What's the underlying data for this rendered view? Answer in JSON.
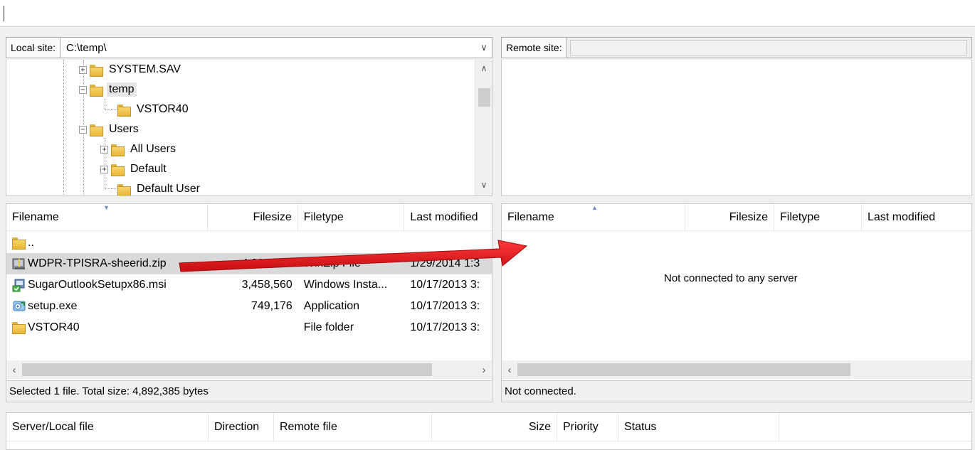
{
  "local_site": {
    "label": "Local site:",
    "path": "C:\\temp\\"
  },
  "remote_site": {
    "label": "Remote site:"
  },
  "tree": [
    {
      "name": "SYSTEM.SAV",
      "expander": "+"
    },
    {
      "name": "temp",
      "expander": "−",
      "selected": true
    },
    {
      "name": "VSTOR40",
      "expander": ""
    },
    {
      "name": "Users",
      "expander": "−"
    },
    {
      "name": "All Users",
      "expander": "+"
    },
    {
      "name": "Default",
      "expander": "+"
    },
    {
      "name": "Default User",
      "expander": ""
    }
  ],
  "local_list": {
    "columns": [
      "Filename",
      "Filesize",
      "Filetype",
      "Last modified"
    ],
    "rows": [
      {
        "name": "..",
        "size": "",
        "type": "",
        "modified": "",
        "icon": "folder-icon"
      },
      {
        "name": "WDPR-TPISRA-sheerid.zip",
        "size": "4,892,385",
        "type": "WinZip File",
        "modified": "1/29/2014 1:3",
        "icon": "zip-icon",
        "selected": true
      },
      {
        "name": "SugarOutlookSetupx86.msi",
        "size": "3,458,560",
        "type": "Windows Insta...",
        "modified": "10/17/2013 3:",
        "icon": "installer-icon"
      },
      {
        "name": "setup.exe",
        "size": "749,176",
        "type": "Application",
        "modified": "10/17/2013 3:",
        "icon": "setup-icon"
      },
      {
        "name": "VSTOR40",
        "size": "",
        "type": "File folder",
        "modified": "10/17/2013 3:",
        "icon": "folder-icon"
      }
    ],
    "status": "Selected 1 file. Total size: 4,892,385 bytes"
  },
  "remote_list": {
    "columns": [
      "Filename",
      "Filesize",
      "Filetype",
      "Last modified"
    ],
    "empty_message": "Not connected to any server",
    "status": "Not connected."
  },
  "queue": {
    "columns": [
      "Server/Local file",
      "Direction",
      "Remote file",
      "Size",
      "Priority",
      "Status"
    ]
  },
  "colors": {
    "annotation_arrow": "#e8141c",
    "selection": "#d9d9d9",
    "folder": "#f2c44e"
  }
}
